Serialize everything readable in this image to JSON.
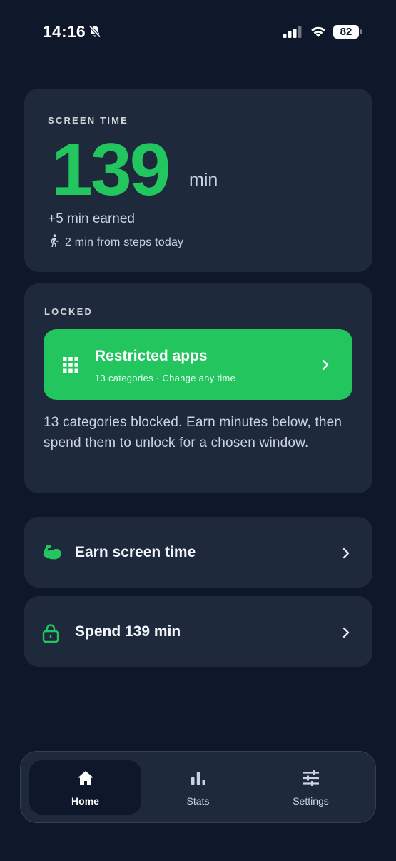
{
  "status_bar": {
    "time": "14:16",
    "battery": "82"
  },
  "screen_time": {
    "label": "SCREEN TIME",
    "value": "139",
    "unit": "min",
    "earned": "+5 min earned",
    "steps": "2 min from steps today"
  },
  "locked": {
    "label": "LOCKED",
    "restricted_title": "Restricted apps",
    "restricted_subtitle": "13 categories · Change any time",
    "description": "13 categories blocked. Earn minutes below, then spend them to unlock for a chosen window."
  },
  "actions": {
    "earn_label": "Earn screen time",
    "spend_label": "Spend 139 min"
  },
  "tabs": [
    {
      "label": "Home",
      "icon": "home-icon",
      "active": true
    },
    {
      "label": "Stats",
      "icon": "stats-icon",
      "active": false
    },
    {
      "label": "Settings",
      "icon": "sliders-icon",
      "active": false
    }
  ],
  "colors": {
    "background": "#0f172a",
    "card": "#1e293b",
    "accent_green": "#22c55e"
  }
}
